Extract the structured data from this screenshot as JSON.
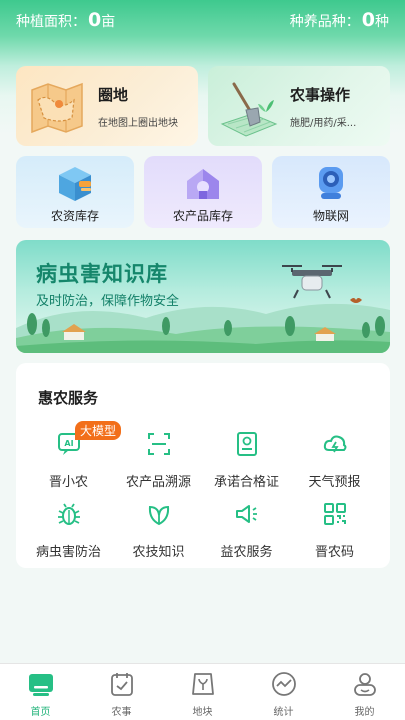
{
  "stats": {
    "area_label": "种植面积：",
    "area_value": "0",
    "area_unit": "亩",
    "species_label": "种养品种：",
    "species_value": "0",
    "species_unit": "种"
  },
  "cards_big": [
    {
      "title": "圈地",
      "subtitle": "在地图上圈出地块",
      "icon": "map-icon"
    },
    {
      "title": "农事操作",
      "subtitle": "施肥/用药/采...",
      "icon": "shovel-icon"
    }
  ],
  "cards_mid": [
    {
      "label": "农资库存",
      "icon": "supply-box-icon"
    },
    {
      "label": "农产品库存",
      "icon": "warehouse-icon"
    },
    {
      "label": "物联网",
      "icon": "camera-icon"
    }
  ],
  "banner": {
    "title": "病虫害知识库",
    "subtitle": "及时防治，保障作物安全"
  },
  "service": {
    "title": "惠农服务",
    "badge": "大模型",
    "items": [
      {
        "label": "晋小农",
        "icon": "ai-icon"
      },
      {
        "label": "农产品溯源",
        "icon": "scan-icon"
      },
      {
        "label": "承诺合格证",
        "icon": "certificate-icon"
      },
      {
        "label": "天气预报",
        "icon": "weather-icon"
      },
      {
        "label": "病虫害防治",
        "icon": "bug-icon"
      },
      {
        "label": "农技知识",
        "icon": "leaf-icon"
      },
      {
        "label": "益农服务",
        "icon": "megaphone-icon"
      },
      {
        "label": "晋农码",
        "icon": "qr-icon"
      }
    ]
  },
  "tabbar": {
    "active": "首页",
    "tabs": [
      {
        "label": "首页",
        "icon": "home-icon"
      },
      {
        "label": "农事",
        "icon": "calendar-check-icon"
      },
      {
        "label": "地块",
        "icon": "plot-icon"
      },
      {
        "label": "统计",
        "icon": "chart-icon"
      },
      {
        "label": "我的",
        "icon": "user-icon"
      }
    ]
  },
  "colors": {
    "brand": "#22b37a",
    "badge": "#f26f1a",
    "banner_text": "#15866b"
  }
}
